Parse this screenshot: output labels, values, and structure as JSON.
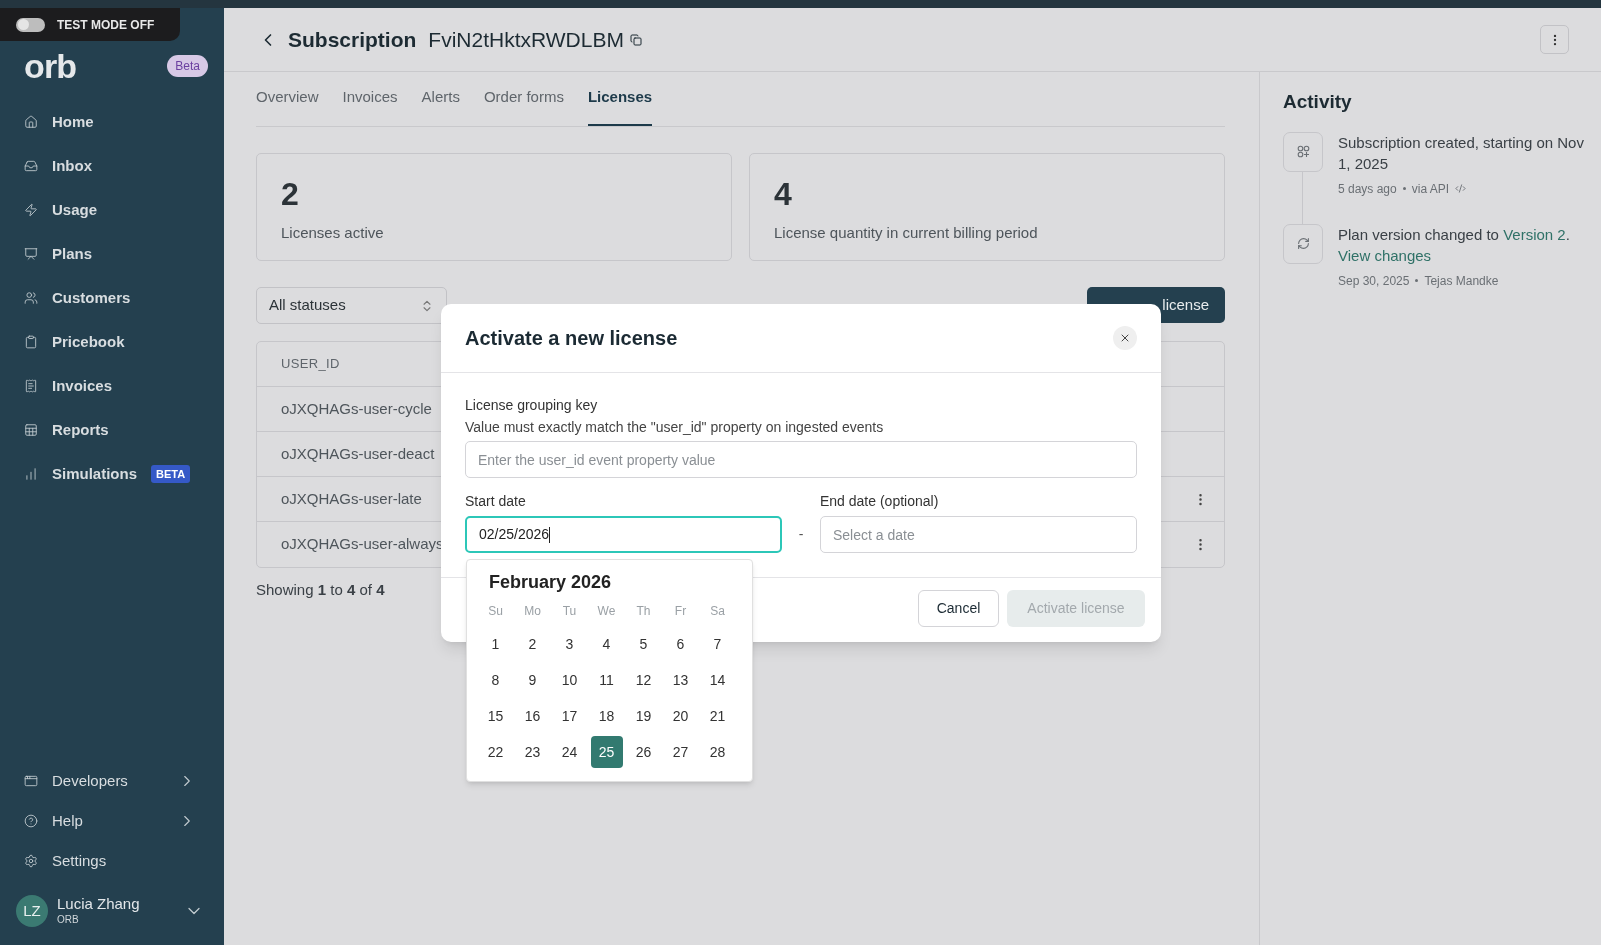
{
  "test_mode": {
    "label": "TEST MODE OFF",
    "on": false
  },
  "brand": {
    "logo": "orb",
    "badge": "Beta"
  },
  "nav": [
    {
      "label": "Home"
    },
    {
      "label": "Inbox"
    },
    {
      "label": "Usage"
    },
    {
      "label": "Plans"
    },
    {
      "label": "Customers"
    },
    {
      "label": "Pricebook"
    },
    {
      "label": "Invoices"
    },
    {
      "label": "Reports"
    },
    {
      "label": "Simulations",
      "badge": "BETA"
    }
  ],
  "nav_bottom": [
    {
      "label": "Developers",
      "chevron": true
    },
    {
      "label": "Help",
      "chevron": true
    },
    {
      "label": "Settings",
      "chevron": false
    }
  ],
  "user": {
    "initials": "LZ",
    "name": "Lucia Zhang",
    "org": "ORB"
  },
  "header": {
    "title": "Subscription",
    "id": "FviN2tHktxRWDLBM"
  },
  "tabs": [
    {
      "label": "Overview",
      "selected": false
    },
    {
      "label": "Invoices",
      "selected": false
    },
    {
      "label": "Alerts",
      "selected": false
    },
    {
      "label": "Order forms",
      "selected": false
    },
    {
      "label": "Licenses",
      "selected": true
    }
  ],
  "stats": [
    {
      "value": "2",
      "label": "Licenses active"
    },
    {
      "value": "4",
      "label": "License quantity in current billing period"
    }
  ],
  "filter": {
    "value": "All statuses"
  },
  "activate_button": "license",
  "table": {
    "columns": [
      "USER_ID"
    ],
    "rows": [
      {
        "user_id": "oJXQHAGs-user-cycle",
        "menu": false
      },
      {
        "user_id": "oJXQHAGs-user-deact",
        "menu": false
      },
      {
        "user_id": "oJXQHAGs-user-late",
        "menu": true
      },
      {
        "user_id": "oJXQHAGs-user-always",
        "menu": true
      }
    ]
  },
  "pagination": "Showing **1** to **4** of **4**",
  "activity": {
    "title": "Activity",
    "events": [
      {
        "kind": "created",
        "text": "Subscription created, starting on Nov 1, 2025",
        "time": "5 days ago",
        "source": "via API"
      },
      {
        "kind": "plan_change",
        "text": "Plan version changed to",
        "link": "Version 2",
        "after": ".",
        "link2": "View changes",
        "time": "Sep 30, 2025",
        "source": "Tejas Mandke"
      }
    ]
  },
  "modal": {
    "title": "Activate a new license",
    "key_label": "License grouping key",
    "key_hint": "Value must exactly match the \"user_id\" property on ingested events",
    "key_placeholder": "Enter the user_id event property value",
    "start_label": "Start date",
    "start_value": "02/25/2026",
    "start_focused": true,
    "separator": "-",
    "end_label": "End date (optional)",
    "end_placeholder": "Select a date",
    "cancel": "Cancel",
    "submit": "Activate license",
    "submit_disabled": true
  },
  "calendar": {
    "month": "February 2026",
    "weekdays": [
      "Su",
      "Mo",
      "Tu",
      "We",
      "Th",
      "Fr",
      "Sa"
    ],
    "days": [
      {
        "label": "1",
        "selected": false
      },
      {
        "label": "2",
        "selected": false
      },
      {
        "label": "3",
        "selected": false
      },
      {
        "label": "4",
        "selected": false
      },
      {
        "label": "5",
        "selected": false
      },
      {
        "label": "6",
        "selected": false
      },
      {
        "label": "7",
        "selected": false
      },
      {
        "label": "8",
        "selected": false
      },
      {
        "label": "9",
        "selected": false
      },
      {
        "label": "10",
        "selected": false
      },
      {
        "label": "11",
        "selected": false
      },
      {
        "label": "12",
        "selected": false
      },
      {
        "label": "13",
        "selected": false
      },
      {
        "label": "14",
        "selected": false
      },
      {
        "label": "15",
        "selected": false
      },
      {
        "label": "16",
        "selected": false
      },
      {
        "label": "17",
        "selected": false
      },
      {
        "label": "18",
        "selected": false
      },
      {
        "label": "19",
        "selected": false
      },
      {
        "label": "20",
        "selected": false
      },
      {
        "label": "21",
        "selected": false
      },
      {
        "label": "22",
        "selected": false
      },
      {
        "label": "23",
        "selected": false
      },
      {
        "label": "24",
        "selected": false
      },
      {
        "label": "25",
        "selected": true
      },
      {
        "label": "26",
        "selected": false
      },
      {
        "label": "27",
        "selected": false
      },
      {
        "label": "28",
        "selected": false
      }
    ]
  }
}
